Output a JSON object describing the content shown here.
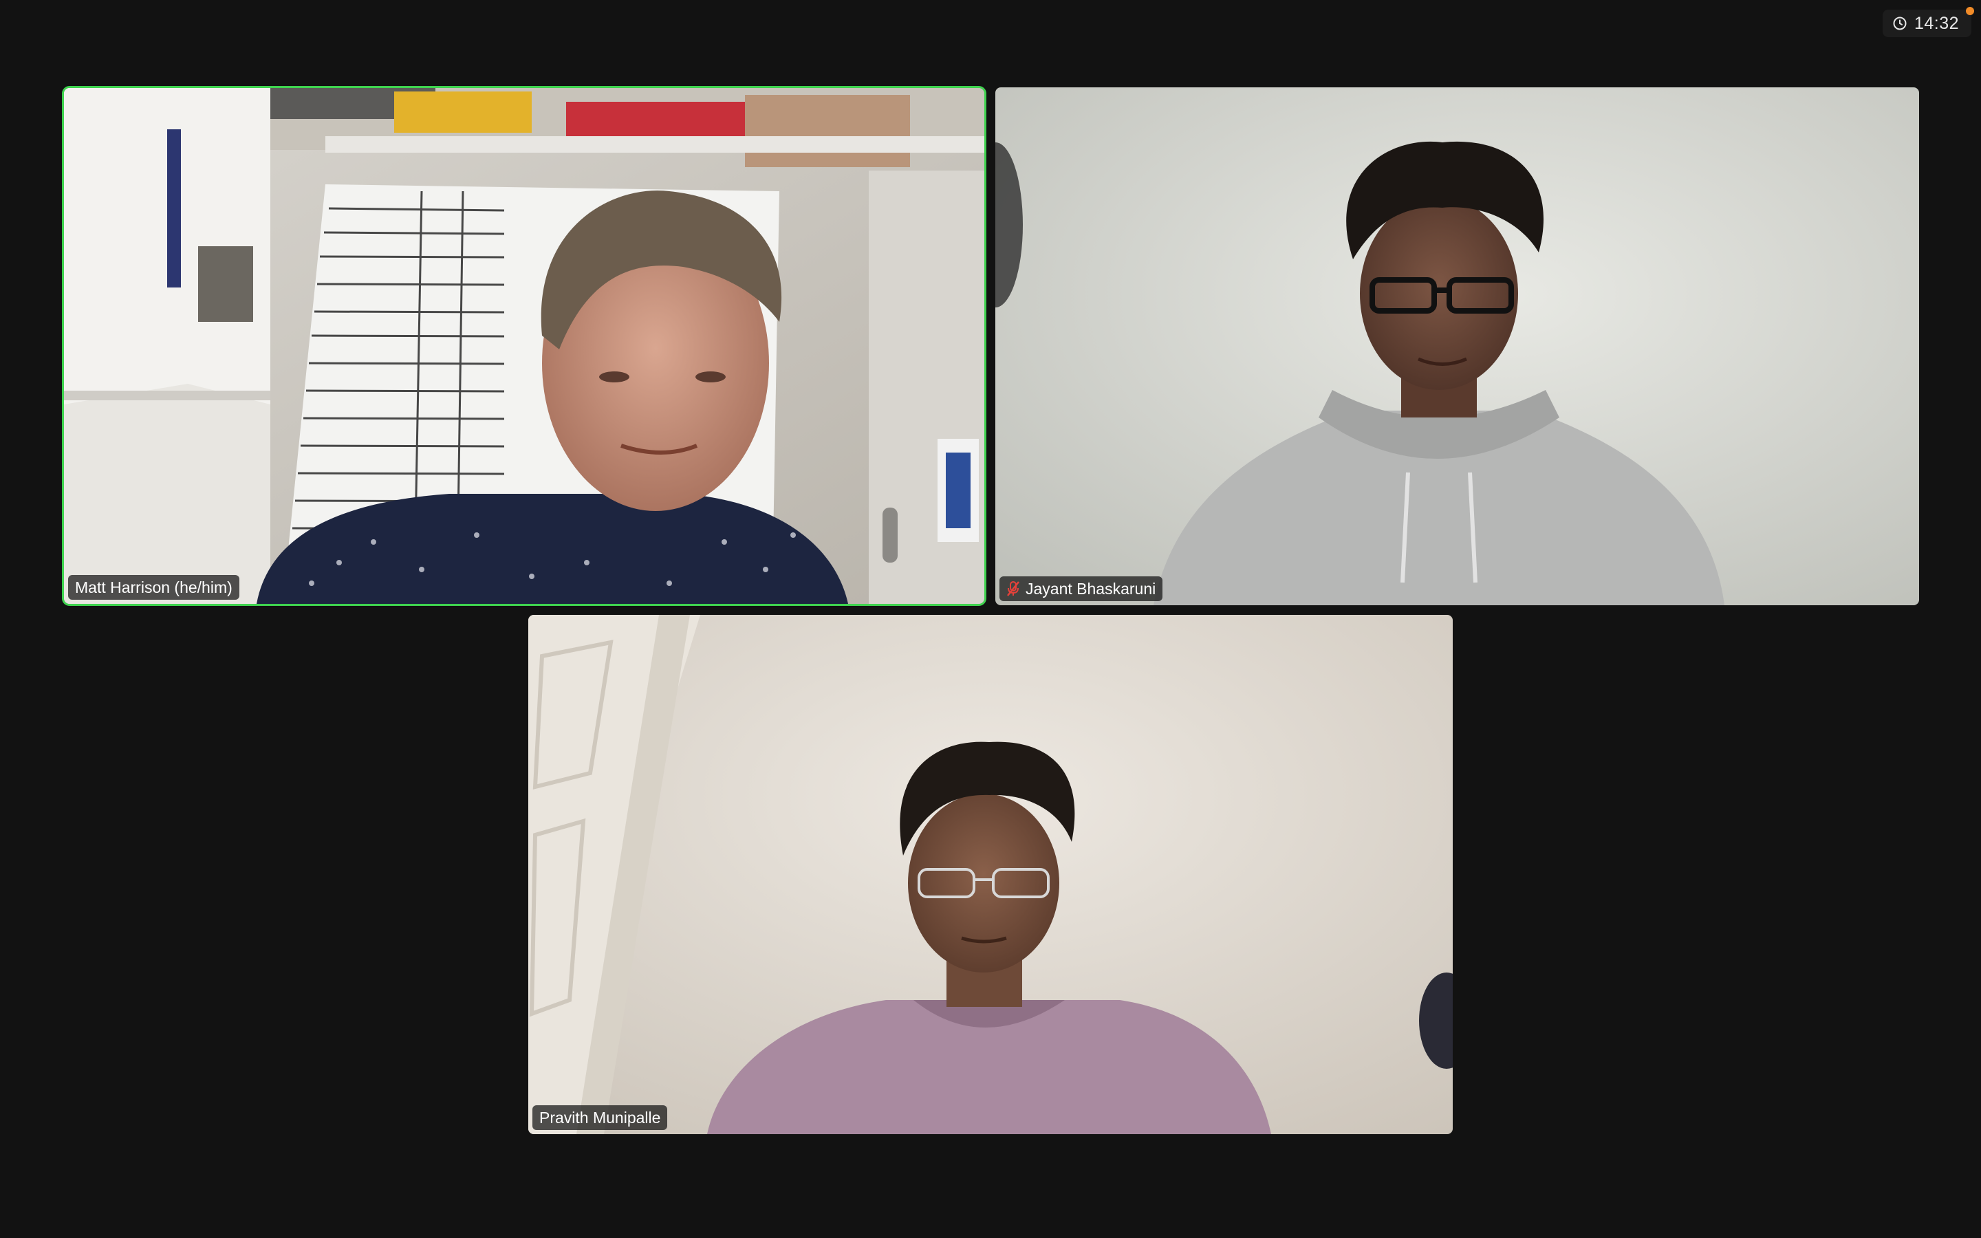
{
  "meeting": {
    "timer": {
      "icon": "clock-icon",
      "text": "14:32",
      "notification_dot_color": "#f28c28"
    },
    "active_speaker_border_color": "#3fd34f",
    "participants": [
      {
        "name": "Matt Harrison (he/him)",
        "active_speaker": true,
        "muted": false
      },
      {
        "name": "Jayant Bhaskaruni",
        "active_speaker": false,
        "muted": true,
        "muted_icon": "mic-muted-icon"
      },
      {
        "name": "Pravith Munipalle",
        "active_speaker": false,
        "muted": false
      }
    ]
  }
}
